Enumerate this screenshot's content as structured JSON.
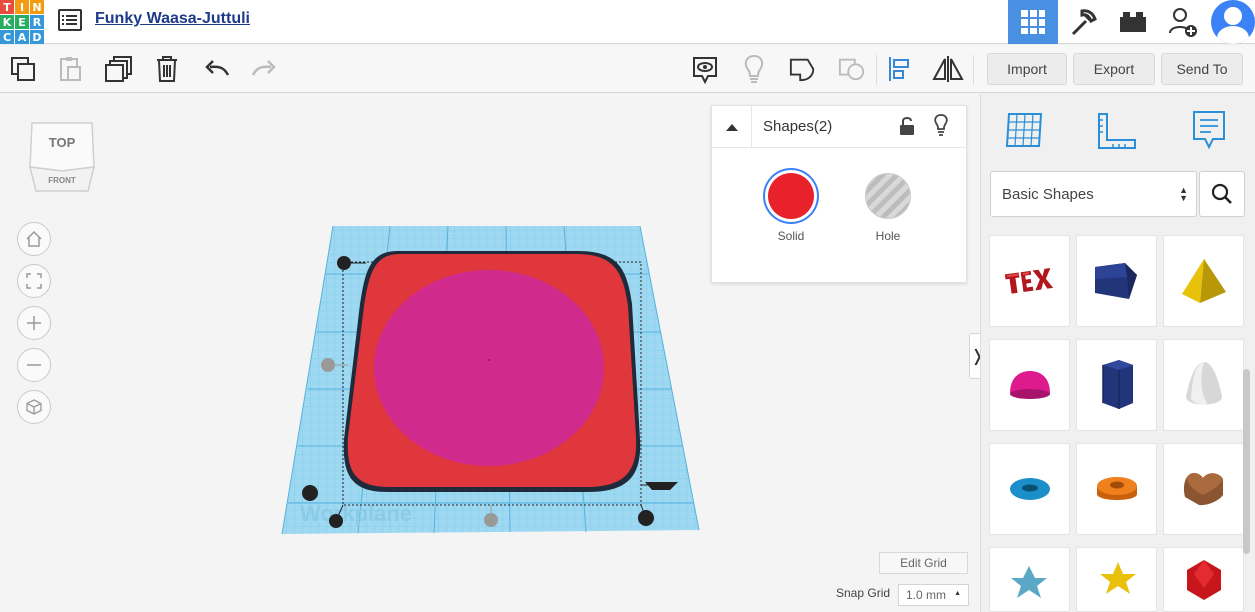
{
  "app": {
    "logo_letters": [
      "T",
      "I",
      "N",
      "K",
      "E",
      "R",
      "C",
      "A",
      "D"
    ],
    "logo_colors": [
      "#e74c3c",
      "#f39c12",
      "#f39c12",
      "#27ae60",
      "#27ae60",
      "#3498db",
      "#3498db",
      "#3498db",
      "#3498db"
    ],
    "design_title": "Funky Waasa-Juttuli"
  },
  "toolbar": {
    "import_label": "Import",
    "export_label": "Export",
    "send_to_label": "Send To"
  },
  "viewcube": {
    "top_label": "TOP",
    "front_label": "FRONT"
  },
  "workplane": {
    "label": "Workplane"
  },
  "inspector": {
    "title": "Shapes(2)",
    "solid_label": "Solid",
    "hole_label": "Hole",
    "solid_color": "#e8212b"
  },
  "shapes_panel": {
    "category": "Basic Shapes"
  },
  "grid": {
    "edit_label": "Edit Grid",
    "snap_label": "Snap Grid",
    "snap_value": "1.0 mm"
  },
  "colors": {
    "accent": "#4a90e2",
    "workplane": "#8fd3ef",
    "box_red": "#e0373d",
    "cylinder_magenta": "#d12a8d"
  }
}
